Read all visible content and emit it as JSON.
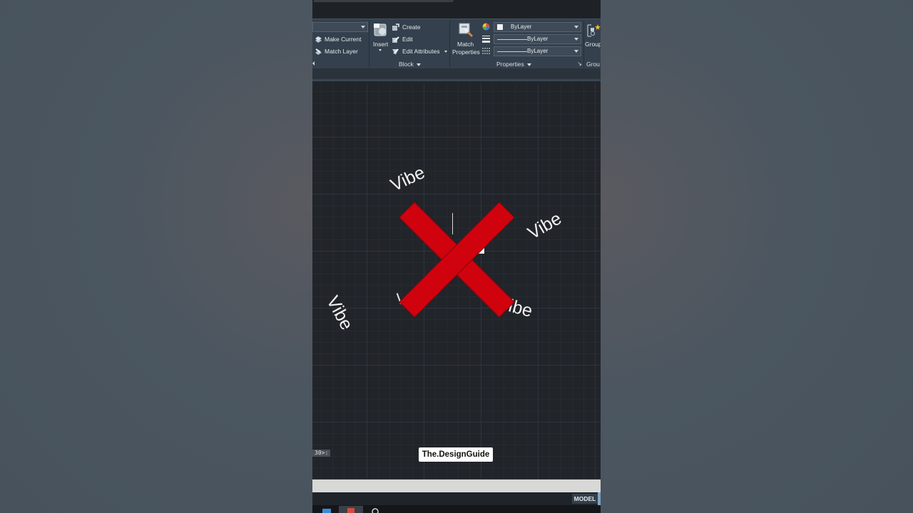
{
  "ribbon": {
    "layers": {
      "make_current": "Make Current",
      "match_layer": "Match Layer"
    },
    "block": {
      "insert": "Insert",
      "create": "Create",
      "edit": "Edit",
      "edit_attributes": "Edit Attributes",
      "title": "Block"
    },
    "properties": {
      "match_line1": "Match",
      "match_line2": "Properties",
      "color_value": "ByLayer",
      "lineweight_value": "ByLayer",
      "linetype_value": "ByLayer",
      "title": "Properties"
    },
    "groups": {
      "label": "Group",
      "title": "Grou"
    }
  },
  "canvas": {
    "texts": [
      "Vibe",
      "Vibe",
      "Vibe",
      "Vibe"
    ],
    "overlay_icon": "red-x-icon",
    "cmd_fragment": "30>:",
    "watermark": "The.DesignGuide"
  },
  "status": {
    "model": "MODEL"
  },
  "colors": {
    "ribbon_bg": "#34404d",
    "canvas_bg": "#212429",
    "cross_red": "#d0020e"
  }
}
